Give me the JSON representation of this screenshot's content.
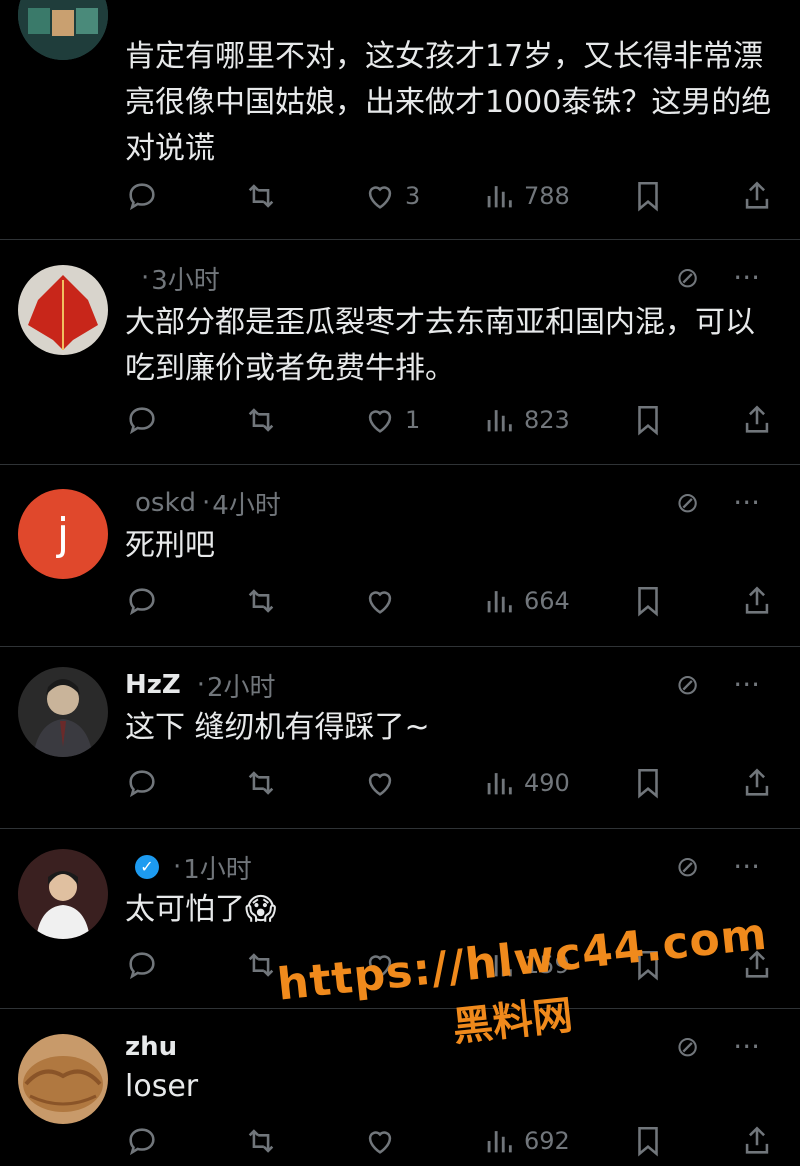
{
  "posts": [
    {
      "username": "",
      "handle": "",
      "time": "",
      "text": "肯定有哪里不对，这女孩才17岁，又长得非常漂亮很像中国姑娘，出来做才1000泰铢？这男的绝对说谎",
      "likes": "3",
      "views": "788"
    },
    {
      "username": "",
      "handle": "",
      "time": "3小时",
      "text": "大部分都是歪瓜裂枣才去东南亚和国内混，可以吃到廉价或者免费牛排。",
      "likes": "1",
      "views": "823"
    },
    {
      "username": "",
      "handle": "oskd",
      "time": "4小时",
      "avatar_letter": "j",
      "text": "死刑吧",
      "likes": "",
      "views": "664"
    },
    {
      "username": "HzZ",
      "handle": "",
      "time": "2小时",
      "text": "这下 缝纫机有得踩了~",
      "likes": "",
      "views": "490"
    },
    {
      "username": "",
      "handle": "",
      "time": "1小时",
      "text": "太可怕了😱",
      "likes": "",
      "views": "159"
    },
    {
      "username": "zhu",
      "handle": "",
      "time": "",
      "text": "loser",
      "likes": "",
      "views": "692"
    }
  ],
  "icons": {
    "reply": "reply-icon",
    "repost": "repost-icon",
    "like": "like-icon",
    "views": "views-icon",
    "bookmark": "bookmark-icon",
    "share": "share-icon",
    "grok": "grok-icon",
    "more": "more-icon"
  },
  "colors": {
    "background": "#000000",
    "text": "#e7e9ea",
    "muted": "#71767b",
    "divider": "#2f3336",
    "verified": "#1d9bf0",
    "avatar_j": "#e0482c",
    "watermark": "#f08a1c"
  },
  "watermark": {
    "url": "https://hlwc44.com",
    "site": "黑料网"
  }
}
